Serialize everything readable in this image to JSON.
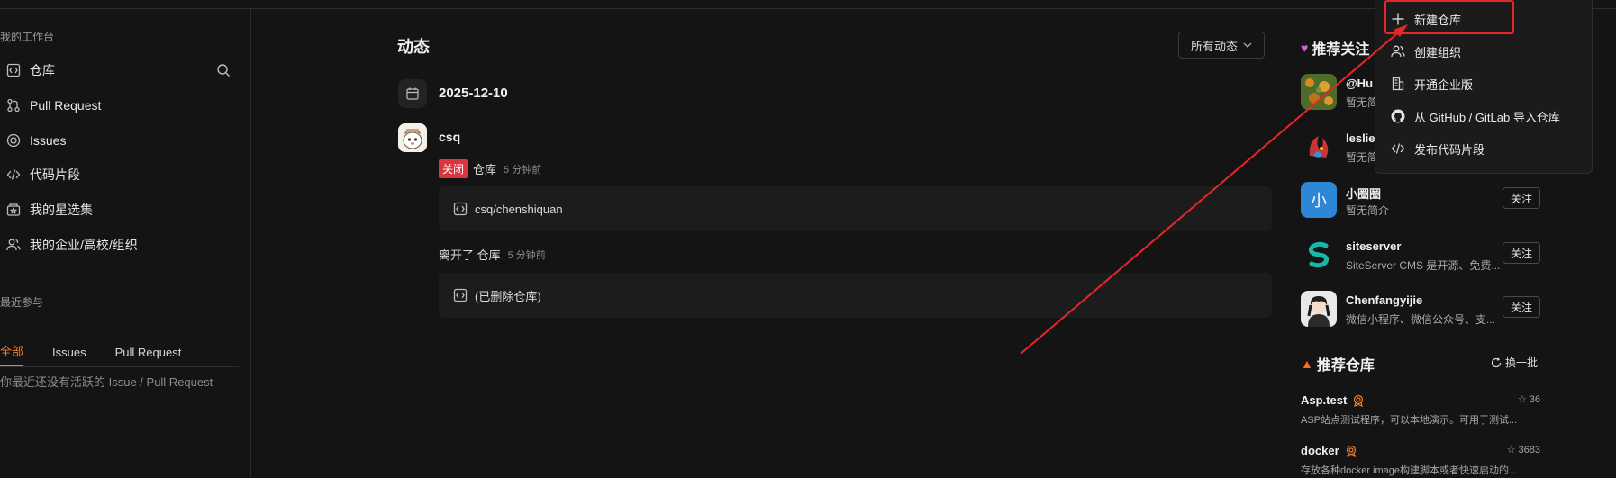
{
  "sidebar": {
    "workspace_title": "我的工作台",
    "items": [
      {
        "label": "仓库",
        "icon": "repo-icon"
      },
      {
        "label": "Pull Request",
        "icon": "pull-request-icon"
      },
      {
        "label": "Issues",
        "icon": "issues-icon"
      },
      {
        "label": "代码片段",
        "icon": "code-icon"
      },
      {
        "label": "我的星选集",
        "icon": "star-collection-icon"
      },
      {
        "label": "我的企业/高校/组织",
        "icon": "organization-icon"
      }
    ],
    "recent_title": "最近参与",
    "tabs": [
      "全部",
      "Issues",
      "Pull Request"
    ],
    "empty_text": "你最近还没有活跃的 Issue / Pull Request"
  },
  "main": {
    "title": "动态",
    "filter_label": "所有动态",
    "date": "2025-12-10",
    "user": "csq",
    "events": [
      {
        "badge": "关闭",
        "text": "仓库",
        "time": "5 分钟前",
        "repo": "csq/chenshiquan"
      },
      {
        "badge": "",
        "text": "离开了 仓库",
        "time": "5 分钟前",
        "repo": "(已删除仓库)"
      }
    ]
  },
  "recommend_users": {
    "title": "推荐关注",
    "users": [
      {
        "name": "@Hu",
        "desc": "暂无简",
        "follow": ""
      },
      {
        "name": "leslie",
        "desc": "暂无简",
        "follow": ""
      },
      {
        "name": "小圈圈",
        "desc": "暂无简介",
        "follow": "关注",
        "avatar_text": "小"
      },
      {
        "name": "siteserver",
        "desc": "SiteServer CMS 是开源、免费...",
        "follow": "关注"
      },
      {
        "name": "Chenfangyijie",
        "desc": "微信小程序、微信公众号、支...",
        "follow": "关注"
      }
    ]
  },
  "recommend_repos": {
    "title": "推荐仓库",
    "refresh": "换一批",
    "repos": [
      {
        "name": "Asp.test",
        "stars": "36",
        "desc": "ASP站点测试程序，可以本地演示。可用于测试..."
      },
      {
        "name": "docker",
        "stars": "3683",
        "desc": "存放各种docker image构建脚本或者快速启动的..."
      }
    ]
  },
  "dropdown": {
    "items": [
      {
        "label": "新建仓库",
        "icon": "plus-icon"
      },
      {
        "label": "创建组织",
        "icon": "organization-icon"
      },
      {
        "label": "开通企业版",
        "icon": "enterprise-icon"
      },
      {
        "label": "从 GitHub / GitLab 导入仓库",
        "icon": "github-icon"
      },
      {
        "label": "发布代码片段",
        "icon": "code-icon"
      }
    ]
  },
  "colors": {
    "background": "#141414",
    "accent": "#f57c22",
    "badge_red": "#d9363e",
    "annotation_red": "#e8262a"
  }
}
